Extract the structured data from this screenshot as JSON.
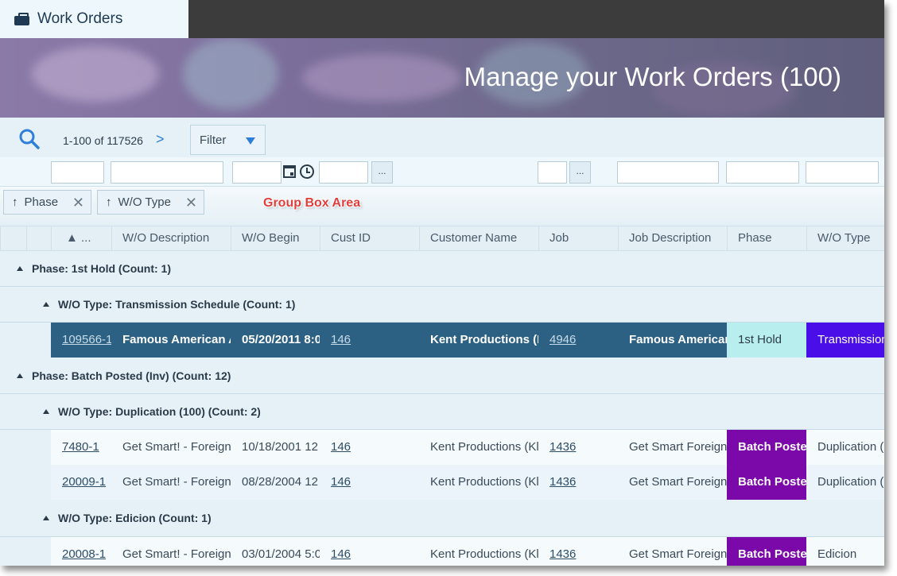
{
  "app": {
    "title": "Work Orders",
    "icon": "briefcase-icon"
  },
  "banner": {
    "headline": "Manage your Work Orders (100)"
  },
  "toolbar": {
    "pager_text": "1-100 of 117526",
    "next_symbol": ">",
    "filter_label": "Filter"
  },
  "filter_row": {
    "ellipsis": "..."
  },
  "group_box": {
    "chips": [
      {
        "label": "Phase",
        "arrow": "↑",
        "remove": "✕"
      },
      {
        "label": "W/O Type",
        "arrow": "↑",
        "remove": "✕"
      }
    ],
    "annotation": "Group Box Area"
  },
  "columns": [
    "▲ ...",
    "W/O Description",
    "W/O Begin",
    "Cust ID",
    "Customer Name",
    "Job",
    "Job Description",
    "Phase",
    "W/O Type"
  ],
  "groups": [
    {
      "level": 1,
      "label": "Phase: 1st Hold (Count: 1)"
    },
    {
      "level": 2,
      "label": "W/O Type: Transmission Schedule (Count: 1)"
    },
    {
      "level": 1,
      "label": "Phase: Batch Posted (Inv) (Count: 12)"
    },
    {
      "level": 2,
      "label": "W/O Type: Duplication (100) (Count: 2)"
    },
    {
      "level": 2,
      "label": "W/O Type: Edicion (Count: 1)"
    }
  ],
  "rows": [
    {
      "wo": "109566-1",
      "desc": "Famous American A",
      "begin": "05/20/2011 8:0",
      "cust_id": "146",
      "customer": "Kent Productions (Kl",
      "job": "4946",
      "job_desc": "Famous American",
      "phase": "1st Hold",
      "wo_type": "Transmission"
    },
    {
      "wo": "7480-1",
      "desc": "Get Smart! - Foreign",
      "begin": "10/18/2001 12",
      "cust_id": "146",
      "customer": "Kent Productions (Kl",
      "job": "1436",
      "job_desc": "Get Smart Foreign",
      "phase": "Batch Posted",
      "wo_type": "Duplication ("
    },
    {
      "wo": "20009-1",
      "desc": "Get Smart! - Foreign",
      "begin": "08/28/2004 12",
      "cust_id": "146",
      "customer": "Kent Productions (Kl",
      "job": "1436",
      "job_desc": "Get Smart Foreign",
      "phase": "Batch Posted",
      "wo_type": "Duplication ("
    },
    {
      "wo": "20008-1",
      "desc": "Get Smart! - Foreign",
      "begin": "03/01/2004 5:0",
      "cust_id": "146",
      "customer": "Kent Productions (Kl",
      "job": "1436",
      "job_desc": "Get Smart Foreign",
      "phase": "Batch Posted",
      "wo_type": "Edicion"
    }
  ],
  "colors": {
    "selected_row": "#2d6183",
    "phase_1st_hold": "#b8eeee",
    "wotype_transmission": "#4a0ee8",
    "phase_batch_posted": "#7b08a8",
    "accent": "#2f7fd8",
    "annotation": "#e23c3c"
  }
}
